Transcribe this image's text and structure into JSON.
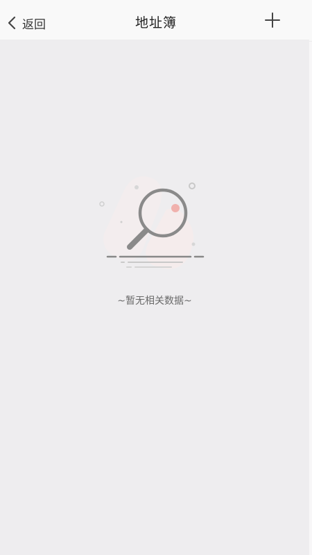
{
  "header": {
    "back_label": "返回",
    "title": "地址簿",
    "back_icon": "chevron-left-icon",
    "add_icon": "plus-icon"
  },
  "empty_state": {
    "message": "~暂无相关数据~",
    "illustration": "magnifier-no-data-illustration"
  },
  "colors": {
    "header_bg": "#f9f9f9",
    "content_bg": "#eeedef",
    "text_primary": "#222222",
    "text_muted": "#6a6a6a",
    "accent_red": "#f0b1ad"
  }
}
